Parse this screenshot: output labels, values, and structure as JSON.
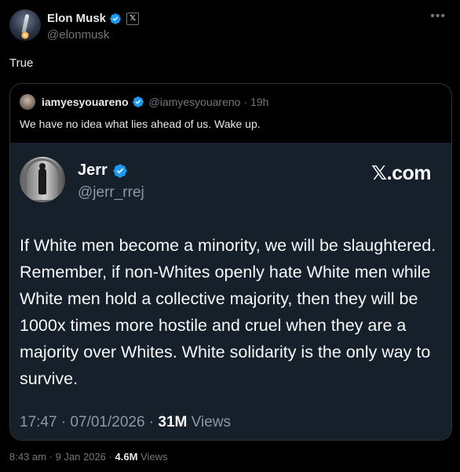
{
  "post": {
    "author": {
      "display_name": "Elon Musk",
      "handle": "@elonmusk",
      "affiliation_badge": "𝕏"
    },
    "more_icon": "•••",
    "text": "True",
    "footer": {
      "time": "8:43 am",
      "separator": "·",
      "date": "9 Jan 2026",
      "separator2": "·",
      "views_count": "4.6M",
      "views_label": "Views"
    }
  },
  "quote": {
    "author": {
      "display_name": "iamyesyouareno",
      "handle": "@iamyesyouareno",
      "separator": "·",
      "time": "19h"
    },
    "text": "We have no idea what lies ahead of us. Wake up.",
    "embedded": {
      "author_name": "Jerr",
      "author_handle": "@jerr_rrej",
      "source_label": "𝕏.com",
      "body": "If White men become a minority, we will be slaughtered. Remember, if non-Whites openly hate White men while White men hold a collective majority, then they will be 1000x times more hostile and cruel when they are a majority over Whites. White solidarity is the only way to survive.",
      "timestamp": "17:47 · 07/01/2026 ·",
      "views_count": "31M",
      "views_label": "Views"
    }
  },
  "colors": {
    "background": "#000000",
    "embedded_background": "#15202b",
    "verified_blue": "#1d9bf0",
    "text_primary": "#e7e9ea",
    "text_secondary": "#71767b"
  }
}
